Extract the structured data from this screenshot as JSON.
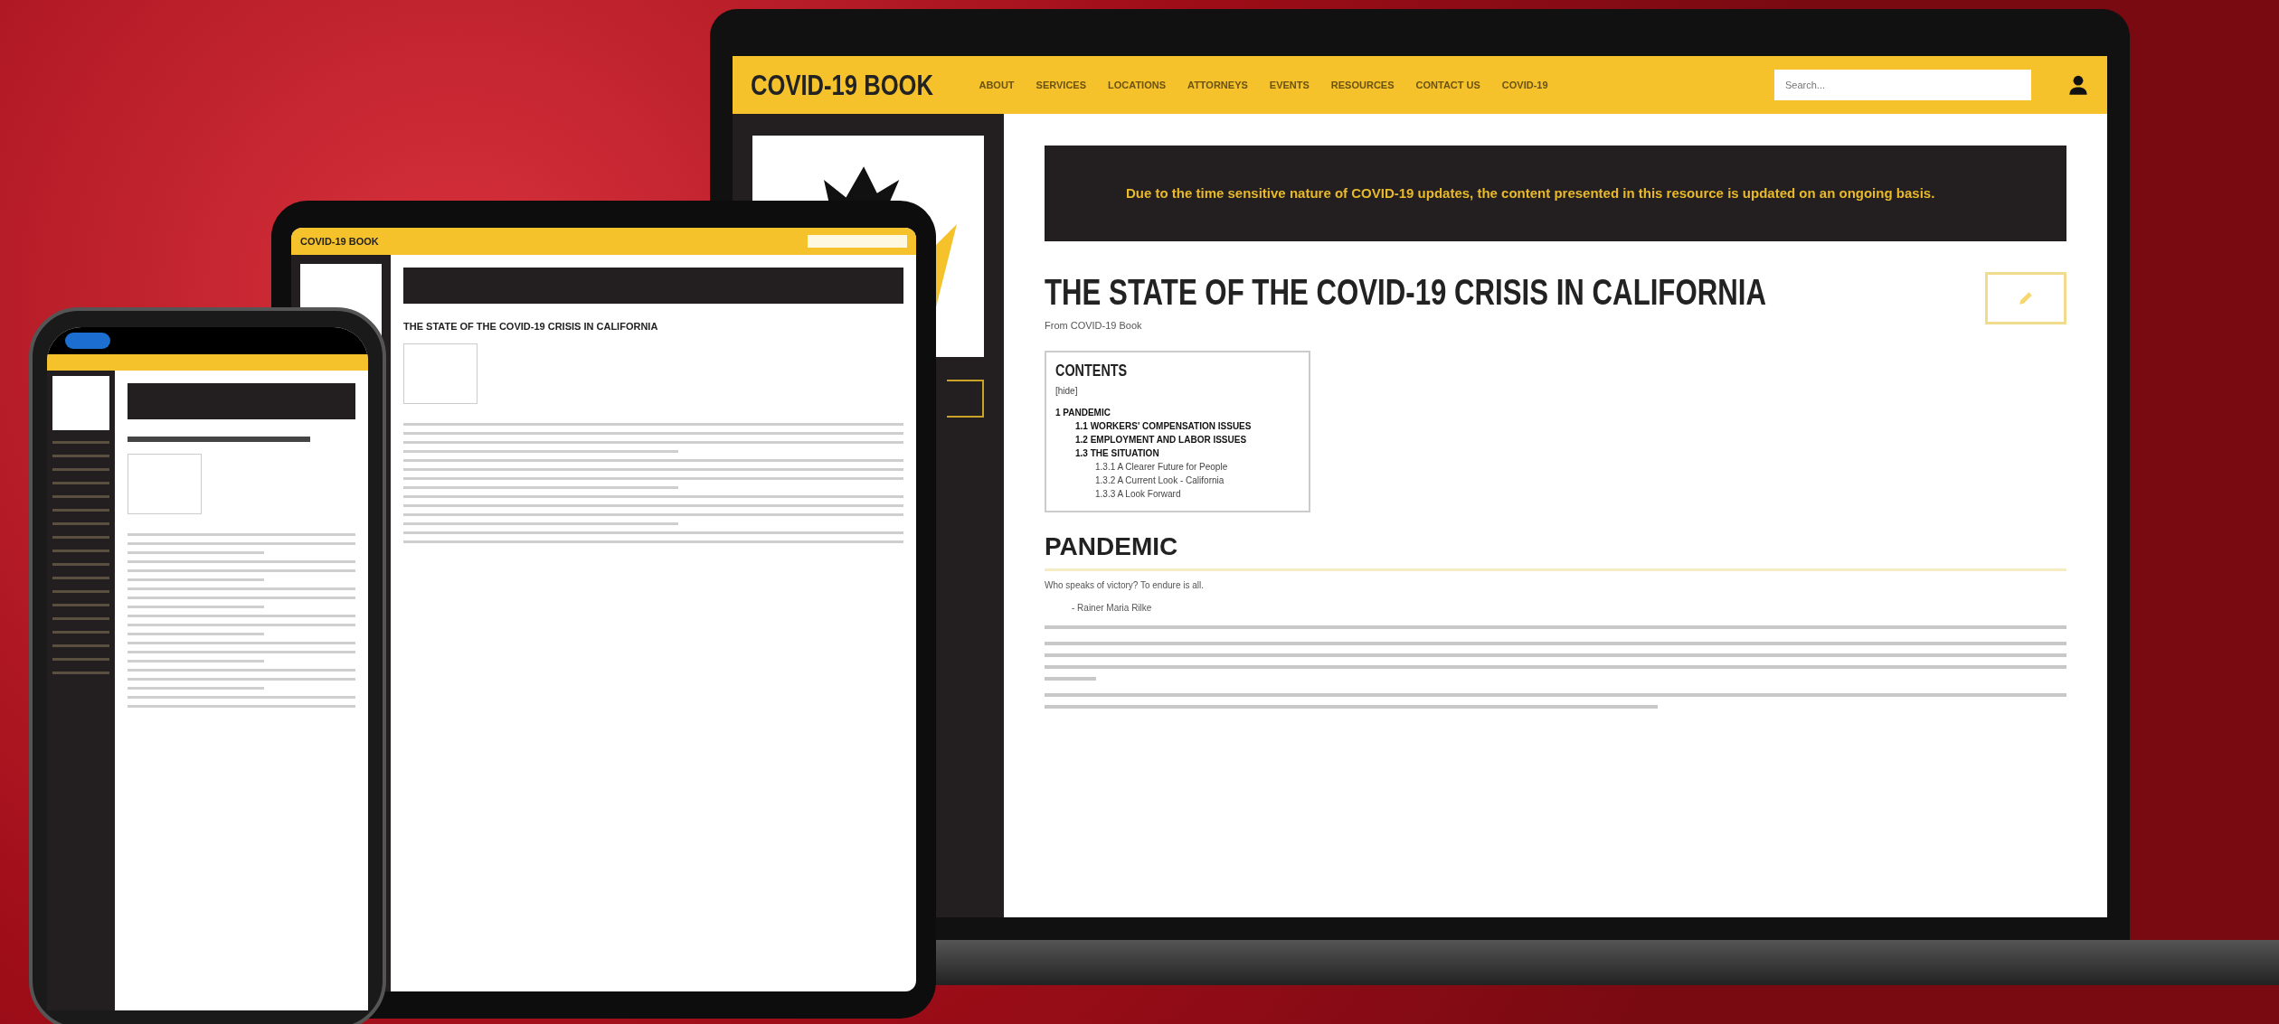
{
  "laptop": {
    "site_title": "COVID-19 BOOK",
    "nav": [
      "ABOUT",
      "SERVICES",
      "LOCATIONS",
      "ATTORNEYS",
      "EVENTS",
      "RESOURCES",
      "CONTACT US",
      "COVID-19"
    ],
    "search": {
      "placeholder": "Search..."
    },
    "notice": "Due to the time sensitive nature of COVID-19 updates, the content presented in this resource is updated on an ongoing basis.",
    "page_title": "THE STATE OF THE COVID-19 CRISIS IN CALIFORNIA",
    "subtitle": "From COVID-19 Book",
    "contents": {
      "title": "CONTENTS",
      "toggle": "[hide]",
      "items": [
        {
          "label": "1 PANDEMIC",
          "children": [
            {
              "label": "1.1 WORKERS' COMPENSATION ISSUES"
            },
            {
              "label": "1.2 EMPLOYMENT AND LABOR ISSUES"
            },
            {
              "label": "1.3 THE SITUATION",
              "children": [
                {
                  "label": "1.3.1 A Clearer Future for People"
                },
                {
                  "label": "1.3.2 A Current Look - California"
                },
                {
                  "label": "1.3.3 A Look Forward"
                }
              ]
            }
          ]
        }
      ]
    },
    "section_heading": "PANDEMIC",
    "quote": "Who speaks of victory? To endure is all.",
    "quote_author": "- Rainer Maria Rilke"
  },
  "tablet": {
    "site_title": "COVID-19 BOOK",
    "page_title": "THE STATE OF THE COVID-19 CRISIS IN CALIFORNIA"
  }
}
